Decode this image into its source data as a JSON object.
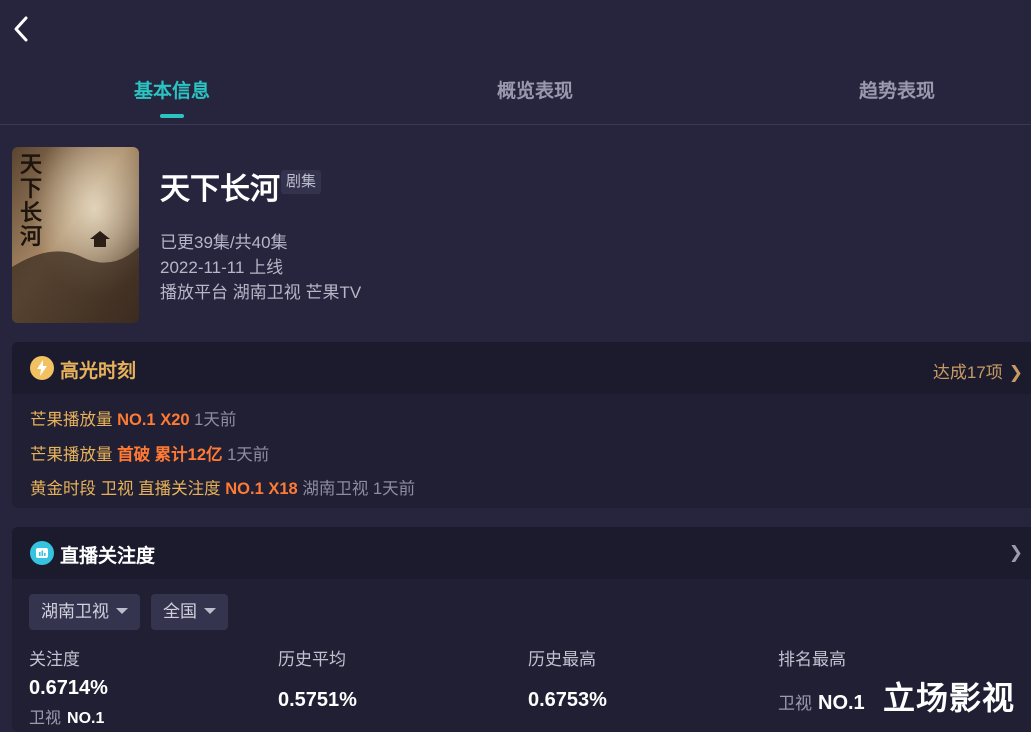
{
  "header": {
    "back_icon": "chevron-left-icon"
  },
  "tabs": [
    {
      "label": "基本信息",
      "active": true
    },
    {
      "label": "概览表现",
      "active": false
    },
    {
      "label": "趋势表现",
      "active": false
    }
  ],
  "show": {
    "poster_text": "天下长河",
    "title": "天下长河",
    "type_badge": "剧集",
    "episodes": "已更39集/共40集",
    "release": "2022-11-11 上线",
    "platforms": "播放平台 湖南卫视 芒果TV"
  },
  "highlights": {
    "icon": "lightning-icon",
    "title": "高光时刻",
    "more": "达成17项",
    "rows": [
      {
        "label": "芒果播放量",
        "value": "NO.1 X20",
        "suffix": "1天前"
      },
      {
        "label": "芒果播放量",
        "value": "首破 累计12亿",
        "suffix": "1天前"
      },
      {
        "label": "黄金时段 卫视 直播关注度",
        "value": "NO.1 X18",
        "suffix": "湖南卫视 1天前"
      }
    ]
  },
  "live": {
    "icon": "chart-icon",
    "title": "直播关注度",
    "filters": [
      "湖南卫视",
      "全国"
    ],
    "stats": [
      {
        "label": "关注度",
        "value": "0.6714%",
        "sub_prefix": "卫视",
        "sub_rank": "NO.1"
      },
      {
        "label": "历史平均",
        "value": "0.5751%"
      },
      {
        "label": "历史最高",
        "value": "0.6753%"
      },
      {
        "label": "排名最高",
        "sub_prefix": "卫视",
        "sub_rank": "NO.1"
      }
    ]
  },
  "watermark": "立场影视",
  "colors": {
    "accent": "#2bc4c2",
    "highlight": "#ff7a35",
    "gold": "#e8b25a",
    "background": "#26253d"
  }
}
